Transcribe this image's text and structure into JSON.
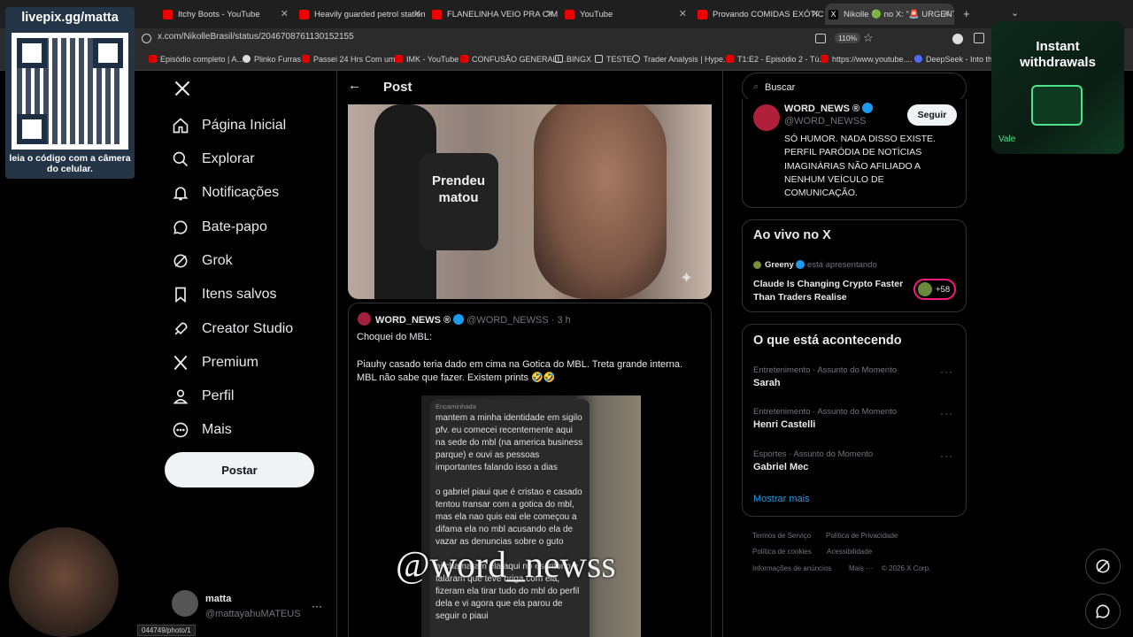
{
  "browser": {
    "tabs": [
      {
        "label": "Itchy Boots - YouTube"
      },
      {
        "label": "Heavily guarded petrol stations"
      },
      {
        "label": "FLANELINHA VEIO PRA CIMA, D"
      },
      {
        "label": "YouTube"
      },
      {
        "label": "Provando COMIDAS EXÓTICAS"
      },
      {
        "label": "Nikolle 🟢 no X: \"🚨 URGENTE"
      }
    ],
    "url": "x.com/NikolleBrasil/status/2046708761130152155",
    "zoom": "110%",
    "bookmarks": [
      "Episódio completo | A...",
      "Plinko Furras",
      "Passei 24 Hrs Com um...",
      "IMK - YouTube",
      "CONFUSÃO GENERALI...",
      "BINGX",
      "TESTE",
      "Trader Analysis | Hype...",
      "T1:E2 - Episódio 2 - Tú...",
      "https://www.youtube....",
      "DeepSeek - Into the"
    ],
    "status_url": "044749/photo/1"
  },
  "overlay": {
    "stream_url": "livepix.gg/matta",
    "qr_caption": "leia o código com a câmera do celular.",
    "ad_line1": "Instant",
    "ad_line2": "withdrawals",
    "ad_small": "Vale",
    "watermark": "@word_newss"
  },
  "sidebar": {
    "items": [
      {
        "label": "Página Inicial",
        "icon": "home-icon"
      },
      {
        "label": "Explorar",
        "icon": "search-icon"
      },
      {
        "label": "Notificações",
        "icon": "bell-icon"
      },
      {
        "label": "Bate-papo",
        "icon": "chat-icon"
      },
      {
        "label": "Grok",
        "icon": "grok-icon"
      },
      {
        "label": "Itens salvos",
        "icon": "bookmark-icon"
      },
      {
        "label": "Creator Studio",
        "icon": "rocket-icon"
      },
      {
        "label": "Premium",
        "icon": "x-logo-icon"
      },
      {
        "label": "Perfil",
        "icon": "user-icon"
      },
      {
        "label": "Mais",
        "icon": "more-circle-icon"
      }
    ],
    "post_button": "Postar",
    "account_name": "matta",
    "account_handle": "@mattayahuMATEUS",
    "account_more": "···"
  },
  "main": {
    "header_title": "Post",
    "quoted": {
      "author": "WORD_NEWS ®",
      "handle": "@WORD_NEWSS",
      "time": "· 3 h",
      "text_line1": "Choquei do MBL:",
      "text_line2": "Piauhy casado teria dado em cima na Gotica do MBL. Treta grande interna. MBL não sabe que fazer. Existem prints 🤣🤣"
    },
    "shirt_text": "Prendeu\nmatou",
    "screenshot": {
      "forwarded": "Encaminhada",
      "p1": "mantem a minha identidade em sigilo pfv. eu comecei recentemente aqui na sede do mbl (na america business parque) e ouvi as pessoas importantes falando isso a dias",
      "p2": "o gabriel piaui que é cristao e casado tentou transar com a gotica do mbl, mas ela nao quis eai ele começou a difama ela no mbl acusando ela de vazar as denuncias sobre o guto",
      "p3": "ai chamaram ela aqui no escritorio e falaram que teve briga com ela, fizeram ela tirar tudo do mbl do perfil dela e vi agora que ela parou de seguir o piaui"
    }
  },
  "right": {
    "search_placeholder": "Buscar",
    "profile": {
      "name": "WORD_NEWS ®",
      "handle": "@WORD_NEWSS",
      "follow": "Seguir",
      "bio": "SÓ HUMOR. NADA DISSO EXISTE. PERFIL PARÓDIA DE NOTÍCIAS IMAGINÁRIAS NÃO AFILIADO A NENHUM VEÍCULO DE COMUNICAÇÃO."
    },
    "live": {
      "title": "Ao vivo no X",
      "host": "Greeny",
      "host_action": "está apresentando",
      "stream_title": "Claude Is Changing Crypto Faster Than Traders Realise",
      "listeners": "+58"
    },
    "trends": {
      "title": "O que está acontecendo",
      "items": [
        {
          "meta": "Entretenimento · Assunto do Momento",
          "name": "Sarah"
        },
        {
          "meta": "Entretenimento · Assunto do Momento",
          "name": "Henri Castelli"
        },
        {
          "meta": "Esportes · Assunto do Momento",
          "name": "Gabriel Mec"
        }
      ],
      "show_more": "Mostrar mais"
    },
    "footer": [
      "Termos de Serviço",
      "Política de Privacidade",
      "Política de cookies",
      "Acessibilidade",
      "Informações de anúncios",
      "Mais ···",
      "© 2026 X Corp."
    ]
  }
}
